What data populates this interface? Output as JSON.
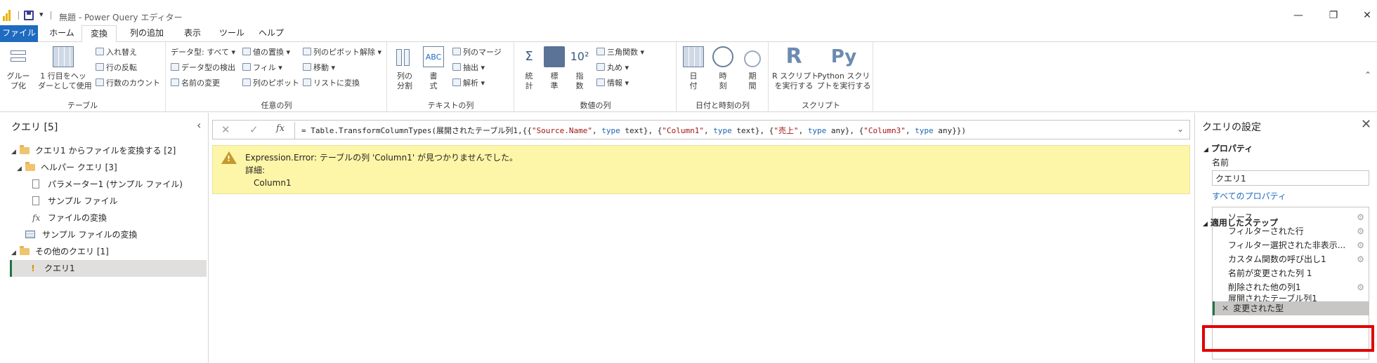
{
  "titlebar": {
    "title": "無題 - Power Query エディター",
    "minimize": "—",
    "restore": "❐",
    "close": "✕"
  },
  "tabs": [
    {
      "label": "ファイル"
    },
    {
      "label": "ホーム"
    },
    {
      "label": "変換"
    },
    {
      "label": "列の追加"
    },
    {
      "label": "表示"
    },
    {
      "label": "ツール"
    },
    {
      "label": "ヘルプ"
    }
  ],
  "ribbon": {
    "table": {
      "label": "テーブル",
      "group_by": "グルー\nプ化",
      "first_row_header": "1 行目をヘッ\nダーとして使用",
      "transpose": "入れ替え",
      "reverse_rows": "行の反転",
      "count_rows": "行数のカウント"
    },
    "any_column": {
      "label": "任意の列",
      "data_type": "データ型: すべて",
      "detect_type": "データ型の検出",
      "rename": "名前の変更",
      "replace_values": "値の置換",
      "fill": "フィル",
      "pivot": "列のピボット",
      "unpivot": "列のピボット解除",
      "move": "移動",
      "to_list": "リストに変換"
    },
    "text_column": {
      "label": "テキストの列",
      "split": "列の\n分割",
      "format": "書\n式",
      "merge": "列のマージ",
      "extract": "抽出",
      "parse": "解析"
    },
    "number_column": {
      "label": "数値の列",
      "statistics": "統\n計",
      "standard": "標\n準",
      "scientific": "指\n数",
      "trig": "三角関数",
      "rounding": "丸め",
      "info": "情報"
    },
    "datetime": {
      "label": "日付と時刻の列",
      "date": "日\n付",
      "time": "時\n刻",
      "duration": "期\n間"
    },
    "scripts": {
      "label": "スクリプト",
      "r": "R スクリプト\nを実行する",
      "python": "Python スクリ\nプトを実行する"
    }
  },
  "left": {
    "title": "クエリ [5]",
    "items": [
      {
        "label": "クエリ1 からファイルを変換する [2]"
      },
      {
        "label": "ヘルパー クエリ [3]"
      },
      {
        "label": "パラメーター1 (サンプル ファイル)"
      },
      {
        "label": "サンプル ファイル"
      },
      {
        "label": "ファイルの変換"
      },
      {
        "label": "サンプル ファイルの変換"
      },
      {
        "label": "その他のクエリ [1]"
      },
      {
        "label": "クエリ1"
      }
    ]
  },
  "formula": {
    "prefix": "= Table.TransformColumnTypes(展開されたテーブル列1,{{",
    "parts": [
      "\"Source.Name\"",
      ", ",
      "type",
      " text}, {",
      "\"Column1\"",
      ", ",
      "type",
      " text}, {",
      "\"売上\"",
      ", ",
      "type",
      " any}, {",
      "\"Column3\"",
      ", ",
      "type",
      " any}})"
    ]
  },
  "error": {
    "message": "Expression.Error: テーブルの列 'Column1' が見つかりませんでした。",
    "details_label": "詳細:",
    "details_value": "Column1"
  },
  "right": {
    "title": "クエリの設定",
    "properties_label": "プロパティ",
    "name_label": "名前",
    "name_value": "クエリ1",
    "all_properties": "すべてのプロパティ",
    "applied_steps_label": "適用したステップ",
    "steps": [
      {
        "label": "ソース"
      },
      {
        "label": "フィルターされた行"
      },
      {
        "label": "フィルター選択された非表示..."
      },
      {
        "label": "カスタム関数の呼び出し1"
      },
      {
        "label": "名前が変更された列 1"
      },
      {
        "label": "削除された他の列1"
      },
      {
        "label": "展開されたテーブル列1"
      },
      {
        "label": "変更された型"
      }
    ]
  },
  "colors": {
    "accent": "#1e6bc0",
    "selection_bar": "#217346",
    "error_bg": "#fdf6a8",
    "highlight": "#e00000"
  }
}
